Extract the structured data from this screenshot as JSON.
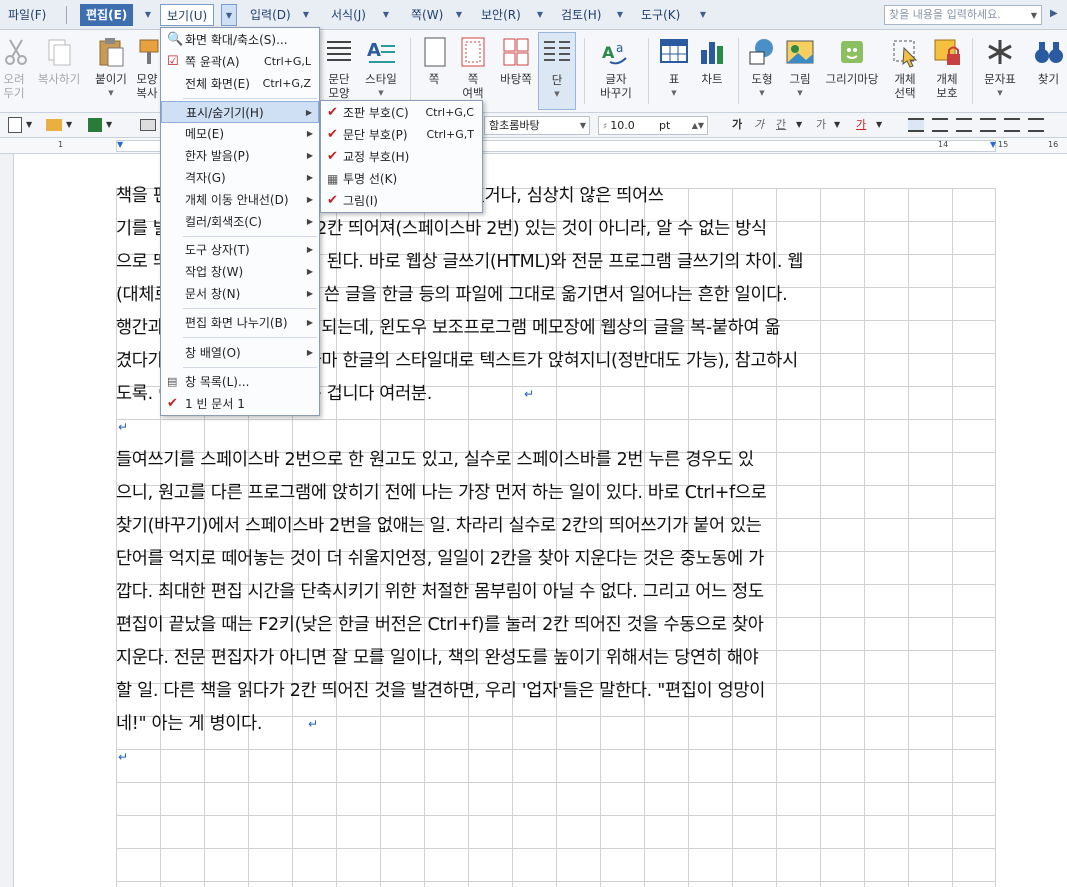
{
  "menubar": {
    "file": "파일(F)",
    "edit": "편집(E)",
    "view": "보기(U)",
    "input": "입력(D)",
    "format": "서식(J)",
    "page": "쪽(W)",
    "security": "보안(R)",
    "review": "검토(H)",
    "tools": "도구(K)",
    "search_placeholder": "찾을 내용을 입력하세요."
  },
  "ribbon": {
    "cut": "오려\n두기",
    "copy": "복사하기",
    "paste": "붙이기",
    "shape_copy": "모양\n복사",
    "para_shape": "문단\n모양",
    "style": "스타일",
    "page": "쪽",
    "page_margin": "쪽\n여백",
    "multi_page": "바탕쪽",
    "column": "단",
    "char_map": "글자\n바꾸기",
    "table": "표",
    "chart": "차트",
    "drawing": "도형",
    "picture": "그림",
    "gallery": "그리기마당",
    "obj_select": "개체\n선택",
    "obj_protect": "개체\n보호",
    "char_table": "문자표",
    "find": "찾기"
  },
  "toolbar": {
    "font": "함초롬바탕",
    "size": "10.0",
    "unit": "pt"
  },
  "view_menu": {
    "zoom": "화면 확대/축소(S)...",
    "page_summary": "쪽 윤곽(A)",
    "page_summary_sc": "Ctrl+G,L",
    "fullscreen": "전체 화면(E)",
    "fullscreen_sc": "Ctrl+G,Z",
    "show_hide": "표시/숨기기(H)",
    "memo": "메모(E)",
    "hanja": "한자 발음(P)",
    "grid": "격자(G)",
    "obj_guide": "개체 이동 안내선(D)",
    "color_gray": "컬러/회색조(C)",
    "toolbox": "도구 상자(T)",
    "work_window": "작업 창(W)",
    "doc_window": "문서 창(N)",
    "split": "편집 화면 나누기(B)",
    "arrange": "창 배열(O)",
    "window_list": "창 목록(L)...",
    "doc1": "1 빈 문서 1"
  },
  "sub_menu": {
    "layout_marks": "조판 부호(C)",
    "layout_marks_sc": "Ctrl+G,C",
    "para_marks": "문단 부호(P)",
    "para_marks_sc": "Ctrl+G,T",
    "proof_marks": "교정 부호(H)",
    "transparent_lines": "투명 선(K)",
    "picture": "그림(I)"
  },
  "document": {
    "lines": [
      "책을 편집하다 보면 유독 행간이 이상하게 벌어져 있거나, 심상치 않은 띄어쓰",
      "기를 발견하게 된다. 단순히 2칸 띄어져(스페이스바 2번) 있는 것이 아니라, 알 수 없는 방식",
      "으로 띄어쓰기가 있음을 알게 된다. 바로 웹상 글쓰기(HTML)와 전문 프로그램 글쓰기의 차이. 웹",
      "(대체로 블로그나 카페 등)에 쓴 글을 한글 등의 파일에 그대로 옮기면서 일어나는 흔한 일이다.",
      "행간과 띄어쓰기가 망가지게 되는데, 윈도우 보조프로그램 메모장에 웹상의 글을 복-붙하여 옮",
      "겼다가 다시 붙여넣으면 그나마 한글의 스타일대로 텍스트가 앉혀지니(정반대도 가능), 참고하시",
      "도록. 이런 글을 보면 좀 쓰는 겁니다 여러분.",
      "",
      "들여쓰기를 스페이스바 2번으로 한 원고도 있고, 실수로 스페이스바를 2번 누른 경우도 있",
      "으니, 원고를 다른 프로그램에 앉히기 전에 나는 가장 먼저 하는 일이 있다. 바로 Ctrl+f으로",
      "찾기(바꾸기)에서 스페이스바 2번을 없애는 일. 차라리 실수로 2칸의 띄어쓰기가 붙어 있는",
      "단어를 억지로 떼어놓는 것이 더 쉬울지언정, 일일이 2칸을 찾아 지운다는 것은 중노동에 가",
      "깝다. 최대한 편집 시간을 단축시키기 위한 처절한 몸부림이 아닐 수 없다. 그리고 어느 정도",
      "편집이 끝났을 때는 F2키(낮은 한글 버전은 Ctrl+f)를 눌러 2칸 띄어진 것을 수동으로 찾아",
      "지운다. 전문 편집자가 아니면 잘 모를 일이나, 책의 완성도를 높이기 위해서는 당연히 해야",
      "할 일. 다른 책을 읽다가 2칸 띄어진 것을 발견하면, 우리 '업자'들은 말한다. \"편집이 엉망이",
      "네!\" 아는 게 병이다.",
      ""
    ]
  }
}
